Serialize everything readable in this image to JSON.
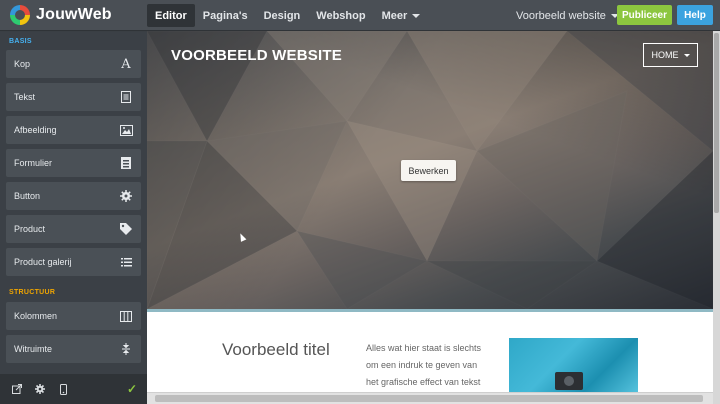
{
  "app": {
    "name": "JouwWeb"
  },
  "nav": {
    "items": [
      {
        "label": "Editor"
      },
      {
        "label": "Pagina's"
      },
      {
        "label": "Design"
      },
      {
        "label": "Webshop"
      },
      {
        "label": "Meer"
      }
    ],
    "site_select": "Voorbeeld website",
    "publish_label": "Publiceer",
    "help_label": "Help"
  },
  "sidebar": {
    "basis_title": "BASIS",
    "basis_items": [
      {
        "label": "Kop",
        "icon": "heading-icon"
      },
      {
        "label": "Tekst",
        "icon": "text-icon"
      },
      {
        "label": "Afbeelding",
        "icon": "image-icon"
      },
      {
        "label": "Formulier",
        "icon": "form-icon"
      },
      {
        "label": "Button",
        "icon": "button-icon"
      },
      {
        "label": "Product",
        "icon": "tag-icon"
      },
      {
        "label": "Product galerij",
        "icon": "list-icon"
      }
    ],
    "structure_title": "STRUCTUUR",
    "structure_items": [
      {
        "label": "Kolommen",
        "icon": "columns-icon"
      },
      {
        "label": "Witruimte",
        "icon": "spacing-icon"
      }
    ],
    "footer_icons": [
      "external-link-icon",
      "gear-icon",
      "mobile-icon",
      "check-icon"
    ]
  },
  "canvas": {
    "hero_title": "VOORBEELD WEBSITE",
    "menu_label": "HOME",
    "edit_label": "Bewerken",
    "content_title": "Voorbeeld titel",
    "content_text": "Alles wat hier staat is slechts om een indruk te geven van het grafische effect van tekst"
  },
  "colors": {
    "accent_basis": "#46b1f0",
    "accent_structure": "#f0a500",
    "publish": "#8cc63f",
    "help": "#3ba3e0"
  }
}
